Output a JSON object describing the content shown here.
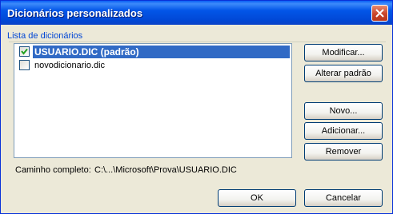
{
  "window": {
    "title": "Dicionários personalizados"
  },
  "group": {
    "label": "Lista de dicionários"
  },
  "dictionaries": [
    {
      "name": "USUARIO.DIC (padrão)",
      "checked": true,
      "selected": true
    },
    {
      "name": "novodicionario.dic",
      "checked": false,
      "selected": false
    }
  ],
  "buttons": {
    "modify": "Modificar...",
    "change_default": "Alterar padrão",
    "new": "Novo...",
    "add": "Adicionar...",
    "remove": "Remover",
    "ok": "OK",
    "cancel": "Cancelar"
  },
  "path": {
    "label": "Caminho completo:",
    "value": "C:\\...\\Microsoft\\Prova\\USUARIO.DIC"
  },
  "colors": {
    "titlebar": "#0356e8",
    "dialog_bg": "#ece9d8",
    "selection": "#316ac5",
    "group_label": "#0046d5"
  }
}
